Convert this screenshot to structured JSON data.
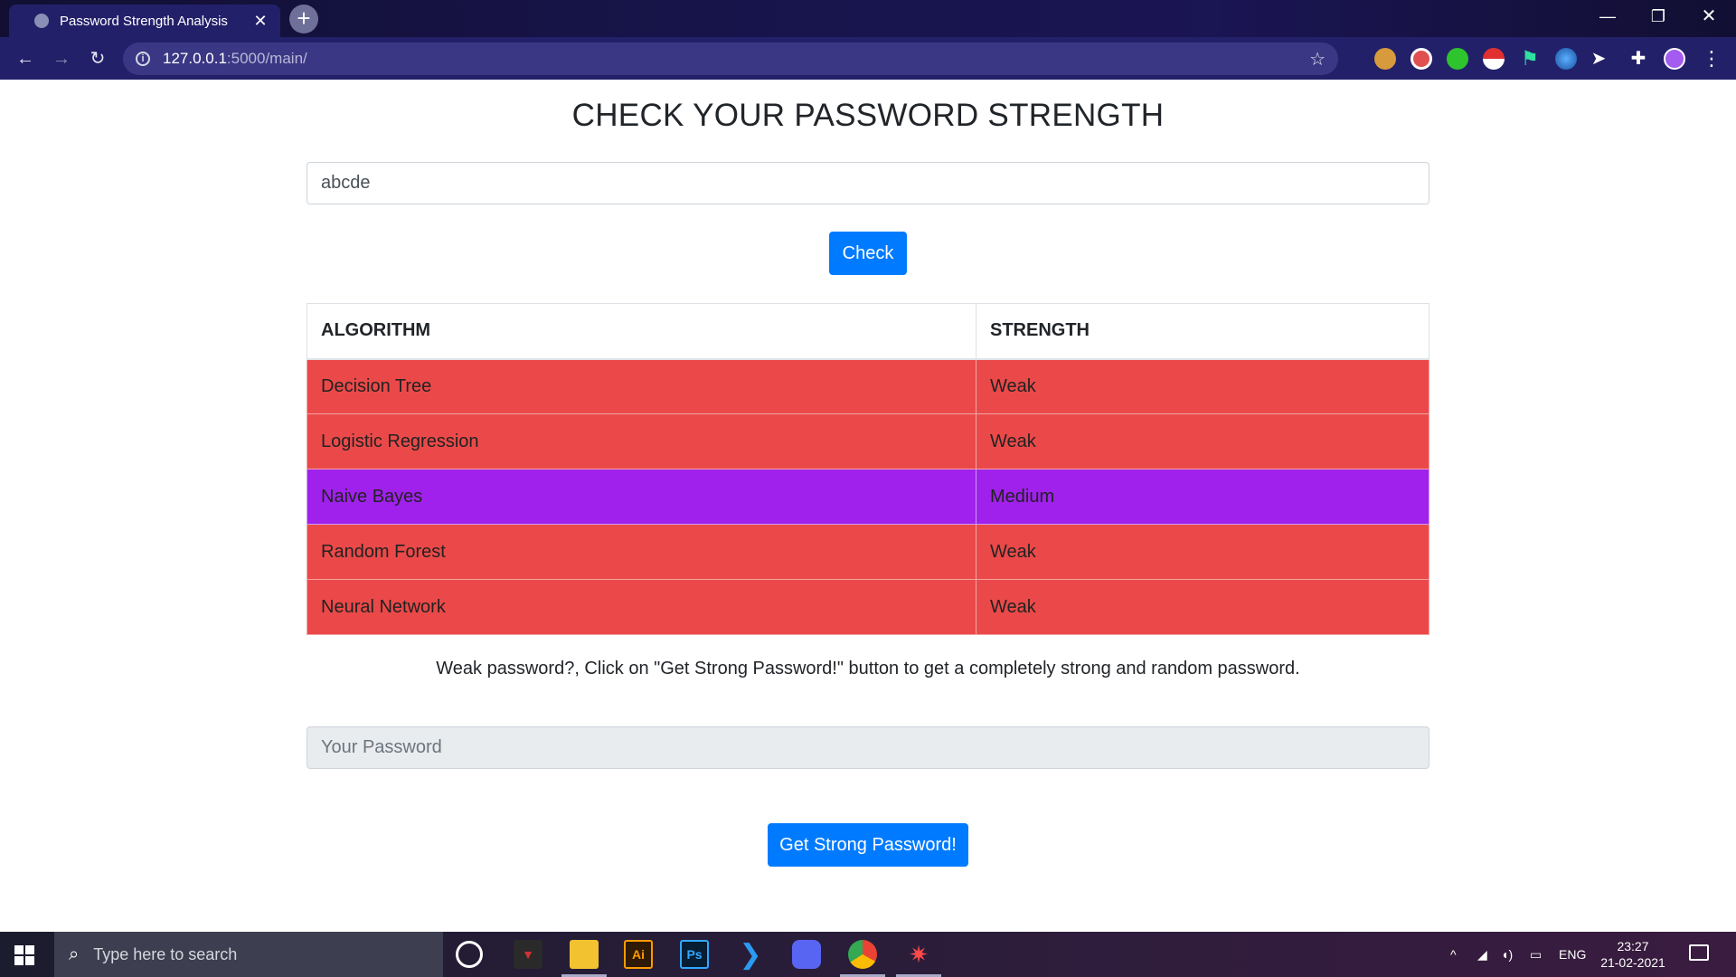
{
  "browser": {
    "tab_title": "Password Strength Analysis",
    "tab_close": "✕",
    "new_tab": "+",
    "url_host": "127.0.0.1",
    "url_path": ":5000/main/",
    "window_controls": {
      "minimize": "—",
      "maximize": "❐",
      "close": "✕"
    },
    "nav": {
      "back": "←",
      "forward": "→",
      "reload": "↻"
    },
    "extensions": [
      "cookie-icon",
      "network-icon",
      "green-extension-icon",
      "pokeball-icon",
      "flag-icon",
      "globe-icon",
      "cursor-icon",
      "puzzle-icon",
      "profile-avatar"
    ]
  },
  "page": {
    "title": "CHECK YOUR PASSWORD STRENGTH",
    "password_value": "abcde",
    "check_button": "Check",
    "table": {
      "headers": [
        "ALGORITHM",
        "STRENGTH"
      ],
      "rows": [
        {
          "algorithm": "Decision Tree",
          "strength": "Weak",
          "color": "#eb4949"
        },
        {
          "algorithm": "Logistic Regression",
          "strength": "Weak",
          "color": "#eb4949"
        },
        {
          "algorithm": "Naive Bayes",
          "strength": "Medium",
          "color": "#a021ec"
        },
        {
          "algorithm": "Random Forest",
          "strength": "Weak",
          "color": "#eb4949"
        },
        {
          "algorithm": "Neural Network",
          "strength": "Weak",
          "color": "#eb4949"
        }
      ]
    },
    "hint": "Weak password?, Click on \"Get Strong Password!\" button to get a completely strong and random password.",
    "generated_placeholder": "Your Password",
    "generate_button": "Get Strong Password!"
  },
  "taskbar": {
    "search_placeholder": "Type here to search",
    "apps": [
      "cortana-icon",
      "predator-icon",
      "file-explorer-icon",
      "illustrator-icon",
      "photoshop-icon",
      "vscode-icon",
      "discord-icon",
      "chrome-icon",
      "spider-app-icon"
    ],
    "illustrator_label": "Ai",
    "photoshop_label": "Ps",
    "language": "ENG",
    "time": "23:27",
    "date": "21-02-2021"
  },
  "colors": {
    "primary_button": "#007bff",
    "weak": "#eb4949",
    "medium": "#a021ec"
  }
}
